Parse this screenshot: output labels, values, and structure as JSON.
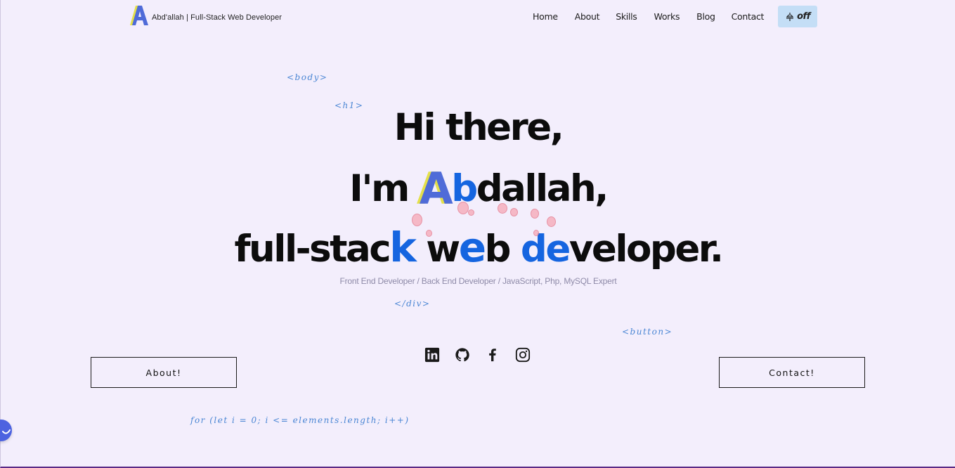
{
  "header": {
    "brand_text": "Abd'allah | Full-Stack Web Developer",
    "logo_letter": "A",
    "nav": [
      {
        "label": "Home"
      },
      {
        "label": "About"
      },
      {
        "label": "Skills"
      },
      {
        "label": "Works"
      },
      {
        "label": "Blog"
      },
      {
        "label": "Contact"
      }
    ],
    "theme_toggle": {
      "label": "off",
      "icon": "lamp-icon"
    }
  },
  "decorations": {
    "body_tag": "<body>",
    "h1_tag": "<h1>",
    "div_close_tag": "</div>",
    "button_tag": "<button>",
    "loop_code": "for (let i = 0; i <= elements.length; i++)"
  },
  "hero": {
    "line1": "Hi there,",
    "line2_pre": "I'm ",
    "line2_a": "A",
    "line2_b": "b",
    "line2_rest": "dallah,",
    "line3_p1": "full-stac",
    "line3_k": "k",
    "line3_p2": " w",
    "line3_e1": "e",
    "line3_p3": "b ",
    "line3_d": "d",
    "line3_e2": "e",
    "line3_p4": "veloper.",
    "subtitle": "Front End Developer / Back End Developer / JavaScript, Php, MySQL Expert"
  },
  "buttons": {
    "about": "About!",
    "contact": "Contact!"
  },
  "social": [
    "linkedin-icon",
    "github-icon",
    "facebook-icon",
    "instagram-icon"
  ],
  "colors": {
    "background": "#f3eefc",
    "accent_blue": "#1565e0",
    "logo_blue": "#4f6bd8",
    "logo_yellow": "#e4e04a",
    "code_blue": "#4a86d4",
    "toggle_bg": "#c4def6"
  }
}
